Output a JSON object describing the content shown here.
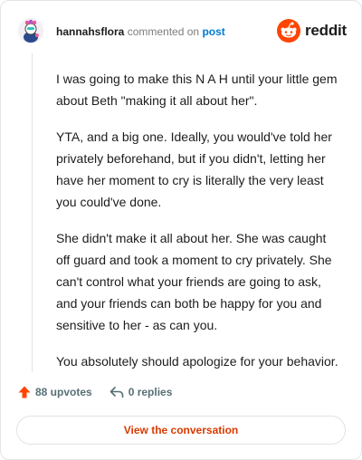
{
  "comment": {
    "username": "hannahsflora",
    "action_text": "commented on",
    "target": "post"
  },
  "brand": {
    "name": "reddit",
    "logo_icon": "reddit-snoo-icon"
  },
  "body": {
    "paragraphs": [
      "I was going to make this N A H until your little gem about Beth \"making it all about her\".",
      "YTA, and a big one. Ideally, you would've told her privately beforehand, but if you didn't, letting her have her moment to cry is literally the very least you could've done.",
      "She didn't make it all about her. She was caught off guard and took a moment to cry privately. She can't control what your friends are going to ask, and your friends can both be happy for you and sensitive to her - as can you.",
      "You absolutely should apologize for your behavior."
    ]
  },
  "actions": {
    "upvotes_label": "88 upvotes",
    "replies_label": "0 replies"
  },
  "cta": {
    "label": "View the conversation"
  },
  "colors": {
    "upvote": "#ff4500",
    "cta_text": "#d93a00",
    "link": "#0079d3"
  }
}
